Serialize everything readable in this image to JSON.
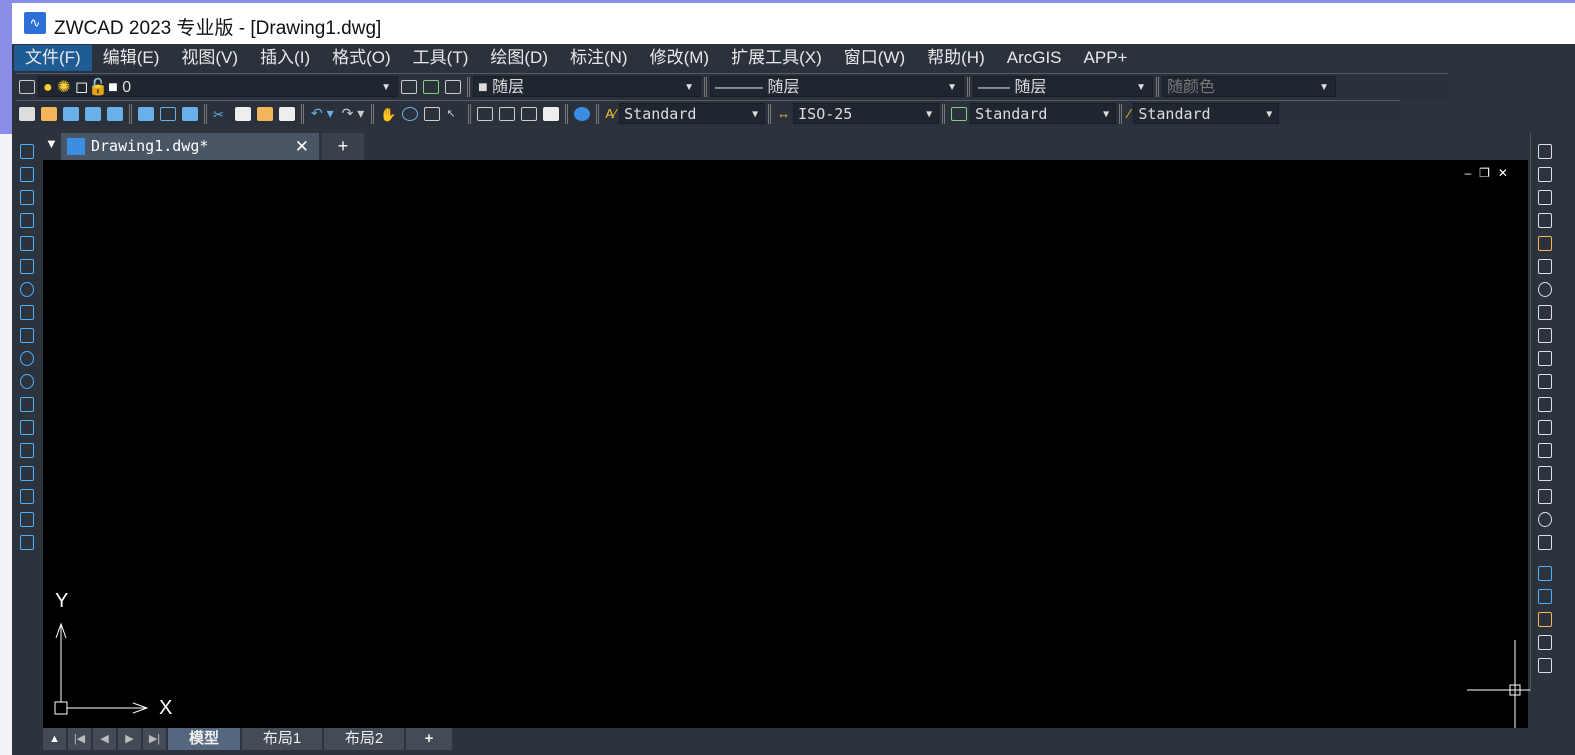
{
  "title": "ZWCAD 2023 专业版 - [Drawing1.dwg]",
  "menu": [
    "文件(F)",
    "编辑(E)",
    "视图(V)",
    "插入(I)",
    "格式(O)",
    "工具(T)",
    "绘图(D)",
    "标注(N)",
    "修改(M)",
    "扩展工具(X)",
    "窗口(W)",
    "帮助(H)",
    "ArcGIS",
    "APP+"
  ],
  "layer": {
    "value": "0"
  },
  "properties": {
    "color": "随层",
    "linetype": "随层",
    "lineweight": "随层",
    "plotstyle": "随颜色"
  },
  "styles": {
    "text": "Standard",
    "dim": "ISO-25",
    "table": "Standard",
    "multileader": "Standard"
  },
  "doc_tab": {
    "label": "Drawing1.dwg*",
    "close": "✕",
    "new": "+"
  },
  "ucs": {
    "x": "X",
    "y": "Y"
  },
  "layout_tabs": [
    "模型",
    "布局1",
    "布局2",
    "+"
  ],
  "colors": {
    "accent": "#1f5c96",
    "canvas": "#000000",
    "icon": "#4fb0ff"
  }
}
